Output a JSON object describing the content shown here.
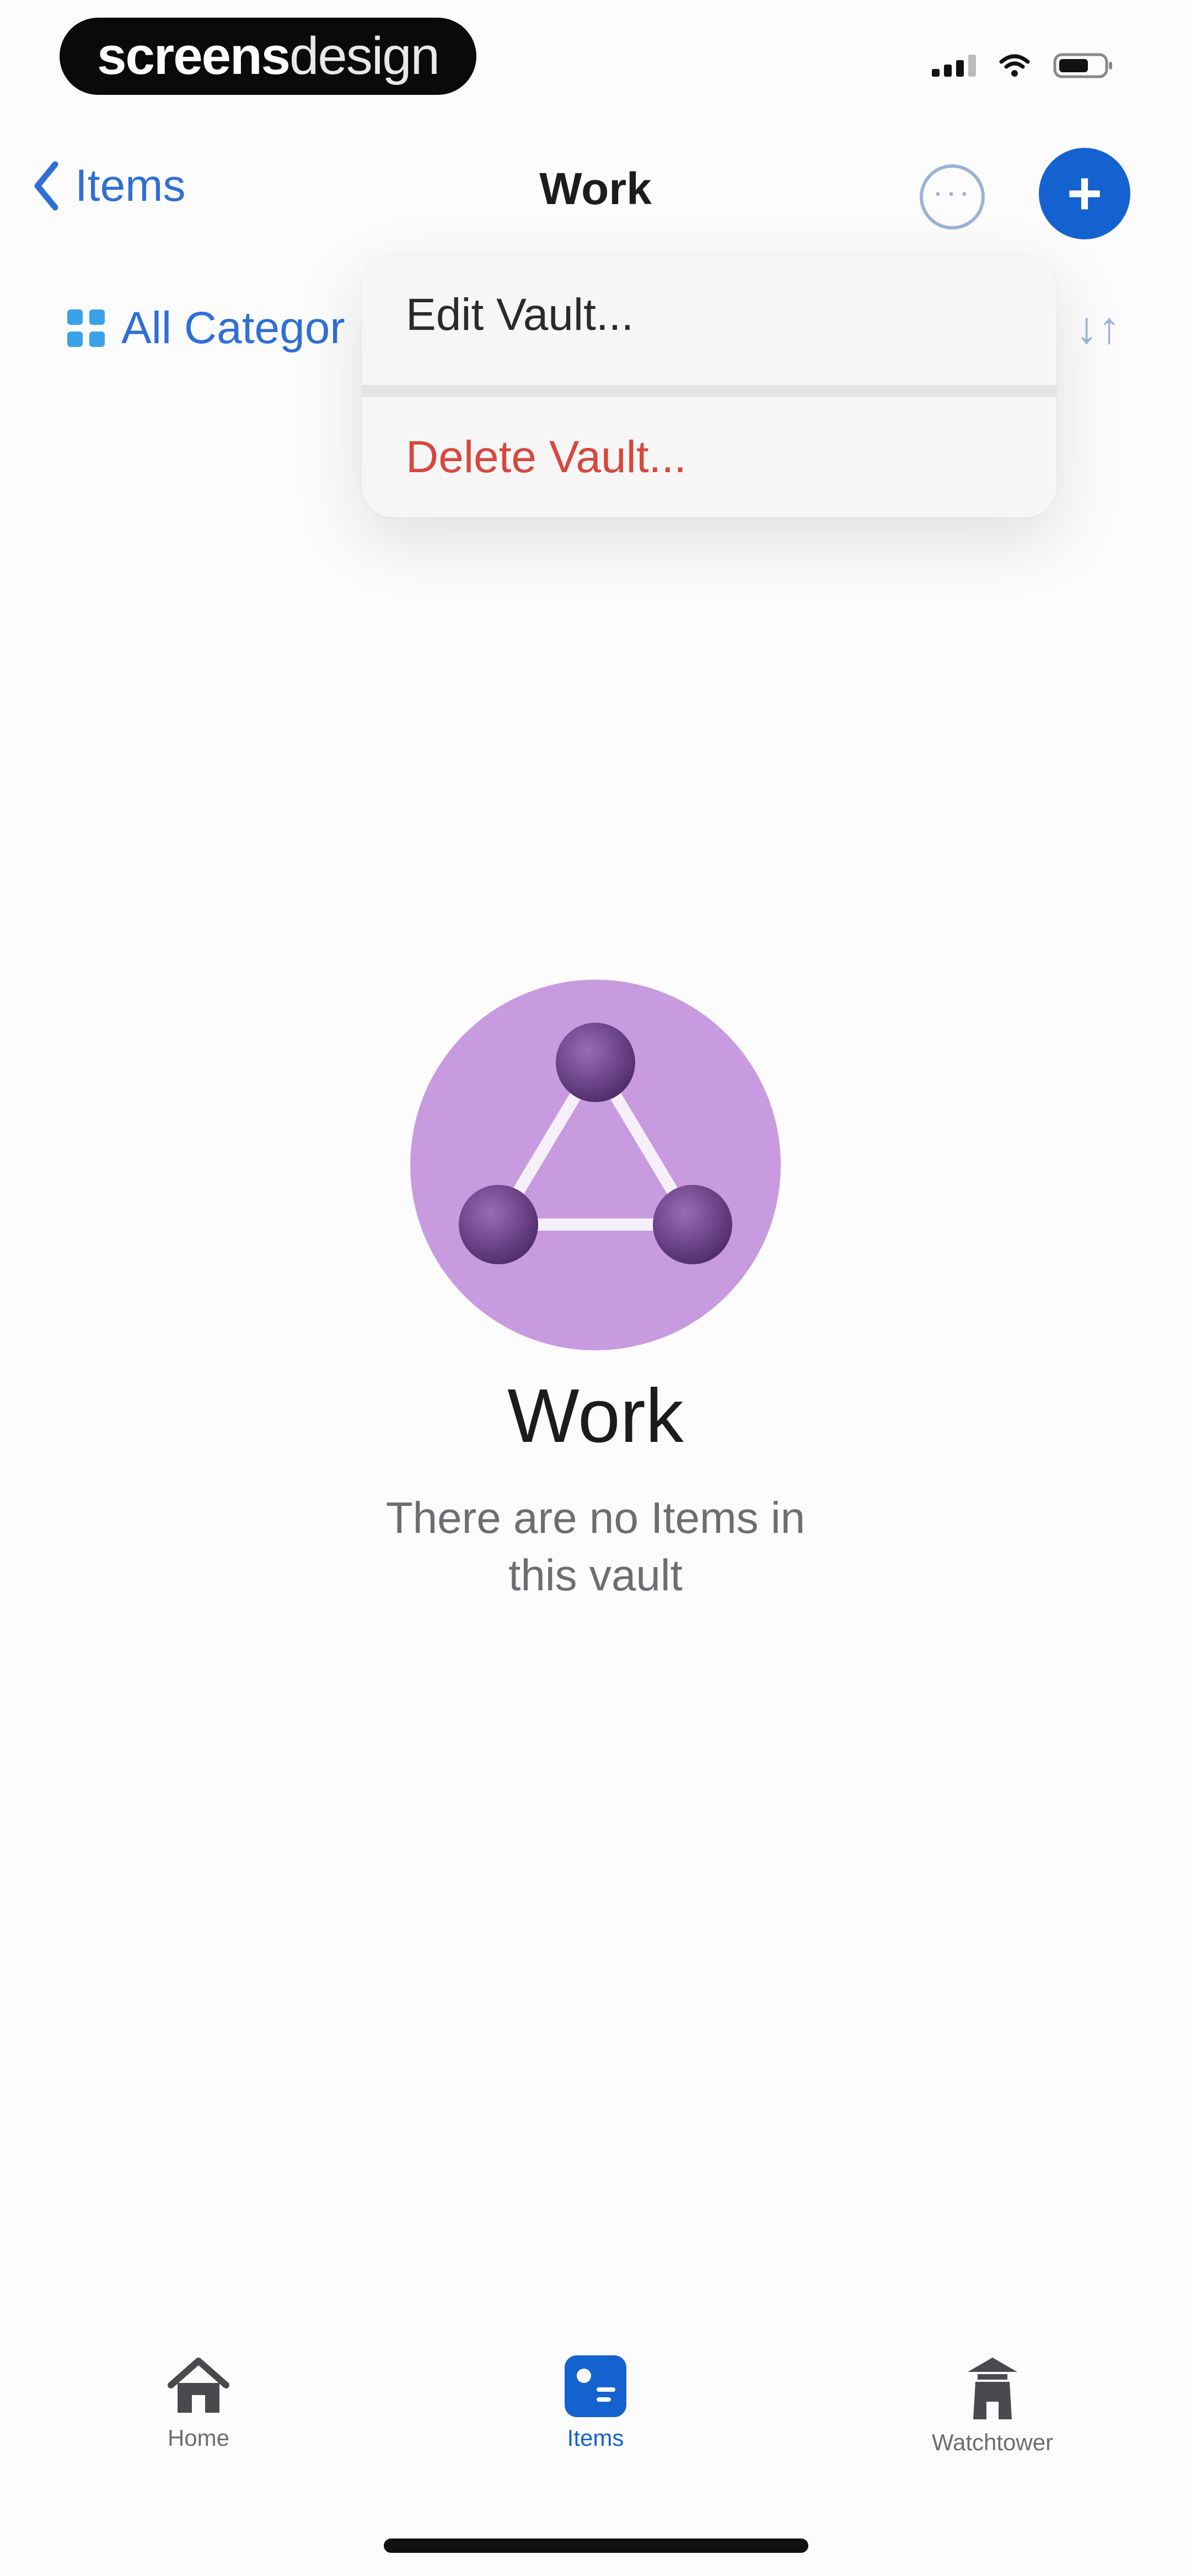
{
  "status_bar": {
    "watermark_bold": "screens",
    "watermark_light": "design"
  },
  "nav": {
    "back_label": "Items",
    "title": "Work",
    "more_icon": "ellipsis-circle-icon",
    "add_icon": "plus-circle-icon"
  },
  "category": {
    "label": "All Categor",
    "sort_glyph": "↓↑"
  },
  "menu": {
    "edit_label": "Edit Vault...",
    "delete_label": "Delete Vault..."
  },
  "vault": {
    "name": "Work",
    "empty_line1": "There are no Items in",
    "empty_line2": "this vault",
    "accent_color": "#c89be0",
    "node_color": "#6b3f8a"
  },
  "tabs": {
    "home": "Home",
    "items": "Items",
    "watchtower": "Watchtower",
    "active": "Items"
  },
  "colors": {
    "link_blue": "#2f6fd6",
    "primary_blue": "#1462cf",
    "destructive_red": "#d9473c"
  }
}
